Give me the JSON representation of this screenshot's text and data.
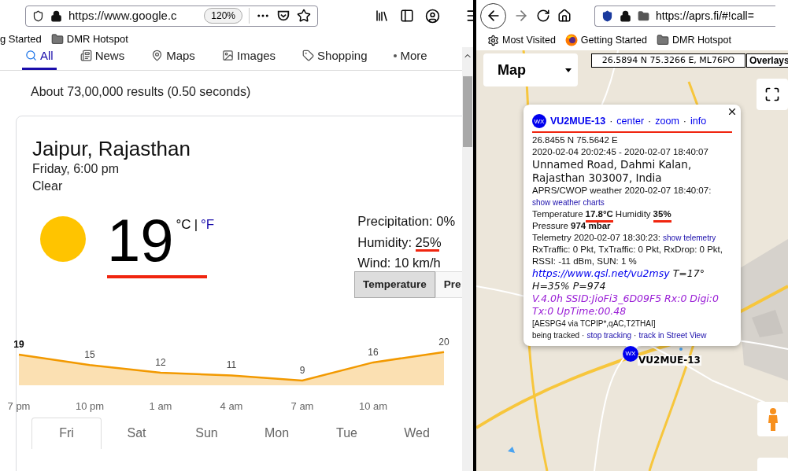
{
  "left_browser": {
    "url": "https://www.google.c",
    "zoom": "120%",
    "bookmarks": [
      {
        "label": "g Started",
        "kind": "plain"
      },
      {
        "label": "DMR Hotspot",
        "kind": "folder"
      }
    ]
  },
  "google": {
    "tabs": [
      {
        "label": "All",
        "kind": "search",
        "selected": true
      },
      {
        "label": "News",
        "kind": "news",
        "selected": false
      },
      {
        "label": "Maps",
        "kind": "maps",
        "selected": false
      },
      {
        "label": "Images",
        "kind": "images",
        "selected": false
      },
      {
        "label": "Shopping",
        "kind": "shopping",
        "selected": false
      },
      {
        "label": "More",
        "kind": "more",
        "selected": false
      }
    ],
    "results": "About 73,00,000 results (0.50 seconds)",
    "weather": {
      "location": "Jaipur, Rajasthan",
      "time": "Friday, 6:00 pm",
      "condition": "Clear",
      "temperature": "19",
      "temperature_marked": true,
      "units": [
        {
          "label": "°C",
          "selected": true
        },
        {
          "label": "°F",
          "selected": false
        }
      ],
      "unit_separator": "|",
      "details": [
        {
          "label": "Precipitation:",
          "value": "0%",
          "marked": false
        },
        {
          "label": "Humidity:",
          "value": "25%",
          "marked": true
        },
        {
          "label": "Wind:",
          "value": "10 km/h",
          "marked": false
        }
      ],
      "modes": [
        {
          "label": "Temperature",
          "selected": true
        },
        {
          "label": "Pre",
          "selected": false
        }
      ],
      "chart_data": {
        "type": "area",
        "categories": [
          "7 pm",
          "10 pm",
          "1 am",
          "4 am",
          "7 am",
          "10 am",
          null
        ],
        "series": [
          {
            "color": "#f29900",
            "values": [
              19,
              15,
              12,
              11,
              9,
              16,
              20
            ]
          }
        ],
        "data_labels": true
      },
      "days": [
        {
          "label": "Fri",
          "selected": true
        },
        {
          "label": "Sat",
          "selected": false
        },
        {
          "label": "Sun",
          "selected": false
        },
        {
          "label": "Mon",
          "selected": false
        },
        {
          "label": "Tue",
          "selected": false
        },
        {
          "label": "Wed",
          "selected": false
        }
      ]
    }
  },
  "right_browser": {
    "url": "https://aprs.fi/#!call=",
    "bookmarks": [
      {
        "label": "Most Visited",
        "kind": "gear"
      },
      {
        "label": "Getting Started",
        "kind": "firefox"
      },
      {
        "label": "DMR Hotspot",
        "kind": "folder"
      }
    ]
  },
  "map": {
    "layer": "Map",
    "coords": "26.5894 N 75.3266 E, ML76PO",
    "overlays": "Overlays",
    "marker": {
      "icon": "WX",
      "label": "VU2MUE-13"
    },
    "popup": {
      "icon": "WX",
      "callsign": "VU2MUE-13",
      "separator": "·",
      "links": [
        "center",
        "zoom",
        "info"
      ],
      "position": "26.8455 N 75.5642 E",
      "period": "2020-02-04 20:02:45 - 2020-02-07 18:40:07",
      "address": "Unnamed Road, Dahmi Kalan, Rajasthan 303007, India",
      "weather_title": "APRS/CWOP weather 2020-02-07 18:40:07:",
      "weather_link": "show weather charts",
      "readings": [
        {
          "label": "Temperature",
          "value": "17.8°C",
          "marked": true
        },
        {
          "label": "Humidity",
          "value": "35%",
          "marked": true
        },
        {
          "label": "Pressure",
          "value": "974 mbar",
          "marked": false
        }
      ],
      "telemetry_title": "Telemetry 2020-02-07 18:30:23:",
      "telemetry_link": "show telemetry",
      "telemetry": "RxTraffic: 0 Pkt, TxTraffic: 0 Pkt, RxDrop: 0 Pkt, RSSI: -11 dBm, SUN: 1 %",
      "comment_link": "https://www.qsl.net/vu2msy",
      "comment": "T=17° H=35% P=974",
      "status": "V.4.0h SSID:JioFi3_6D09F5 Rx:0 Digi:0 Tx:0 UpTime:00.48",
      "path": "[AESPG4 via TCPIP*,qAC,T2THAI]",
      "tracking": "being tracked",
      "tracking_links": [
        "stop tracking",
        "track in Street View"
      ]
    }
  }
}
